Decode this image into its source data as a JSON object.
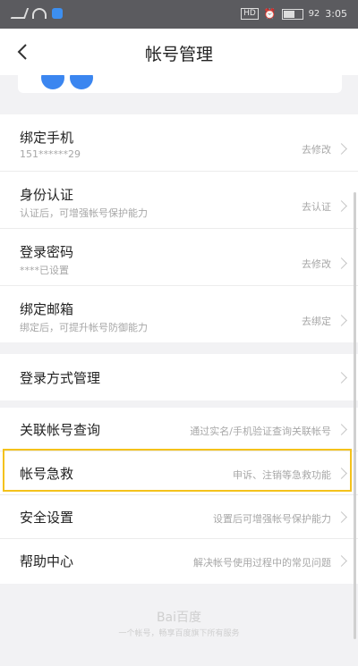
{
  "statusbar": {
    "battery": "92",
    "time": "3:05"
  },
  "header": {
    "title": "帐号管理"
  },
  "section_account": [
    {
      "title": "绑定手机",
      "subtitle": "151******29",
      "action": "去修改"
    },
    {
      "title": "身份认证",
      "subtitle": "认证后，可增强帐号保护能力",
      "action": "去认证"
    },
    {
      "title": "登录密码",
      "subtitle": "****已设置",
      "action": "去修改"
    },
    {
      "title": "绑定邮箱",
      "subtitle": "绑定后，可提升帐号防御能力",
      "action": "去绑定"
    }
  ],
  "login_method": {
    "title": "登录方式管理"
  },
  "section_more": [
    {
      "title": "关联帐号查询",
      "desc": "通过实名/手机验证查询关联帐号"
    },
    {
      "title": "帐号急救",
      "desc": "申诉、注销等急救功能"
    },
    {
      "title": "安全设置",
      "desc": "设置后可增强帐号保护能力"
    },
    {
      "title": "帮助中心",
      "desc": "解决帐号使用过程中的常见问题"
    }
  ],
  "footer": {
    "logo": "Bai百度",
    "text": "一个帐号，畅享百度旗下所有服务"
  }
}
